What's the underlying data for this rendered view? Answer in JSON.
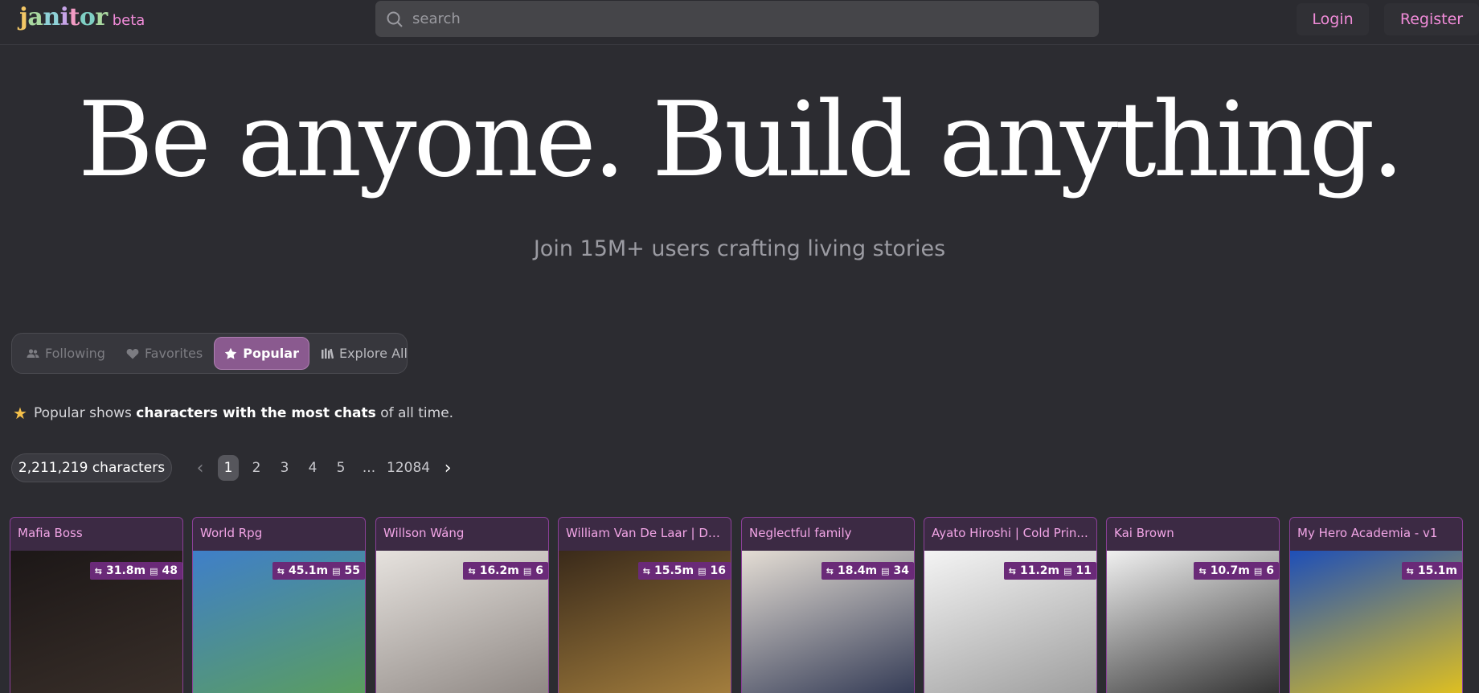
{
  "header": {
    "logo_text": "janitor",
    "beta_label": "beta",
    "search_placeholder": "search",
    "login_label": "Login",
    "register_label": "Register"
  },
  "hero": {
    "title": "Be anyone. Build anything.",
    "subtitle": "Join 15M+ users crafting living stories"
  },
  "tabs": [
    {
      "label": "Following",
      "icon": "users-icon"
    },
    {
      "label": "Favorites",
      "icon": "heart-icon"
    },
    {
      "label": "Popular",
      "icon": "star-icon",
      "active": true
    },
    {
      "label": "Explore All",
      "icon": "library-icon"
    }
  ],
  "note": {
    "prefix": "Popular shows",
    "bold": "characters with the most chats",
    "suffix": "of all time."
  },
  "count_label": "2,211,219 characters",
  "pagination": {
    "pages": [
      "1",
      "2",
      "3",
      "4",
      "5"
    ],
    "ellipsis": "...",
    "last": "12084",
    "current": "1"
  },
  "cards": [
    {
      "title": "Mafia Boss",
      "chats": "31.8m",
      "files": "48",
      "colors": [
        "#1c1717",
        "#3a302a"
      ]
    },
    {
      "title": "World Rpg",
      "chats": "45.1m",
      "files": "55",
      "colors": [
        "#3f7fc9",
        "#5c9f5a"
      ]
    },
    {
      "title": "Willson Wáng",
      "chats": "16.2m",
      "files": "6",
      "colors": [
        "#e6e2de",
        "#8b8480"
      ]
    },
    {
      "title": "William Van De Laar | Du...",
      "chats": "15.5m",
      "files": "16",
      "colors": [
        "#3a2a1a",
        "#a8823f"
      ]
    },
    {
      "title": "Neglectful family",
      "chats": "18.4m",
      "files": "34",
      "colors": [
        "#e4ddd4",
        "#2c3450"
      ]
    },
    {
      "title": "Ayato Hiroshi | Cold Prin...",
      "chats": "11.2m",
      "files": "11",
      "colors": [
        "#f4f4f4",
        "#9a9a9a"
      ]
    },
    {
      "title": "Kai Brown",
      "chats": "10.7m",
      "files": "6",
      "colors": [
        "#f0f0f0",
        "#2a2a2a"
      ]
    },
    {
      "title": "My Hero Academia - v1",
      "chats": "15.1m",
      "files": "",
      "colors": [
        "#1e4fb8",
        "#e8c519"
      ]
    }
  ]
}
